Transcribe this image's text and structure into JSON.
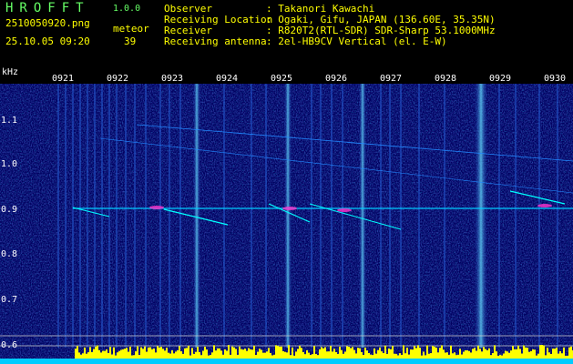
{
  "header": {
    "app_title": "HROFFT",
    "app_version": "1.0.0",
    "filename": "2510050920.png",
    "meteor_label": "meteor",
    "datetime": "25.10.05 09:20",
    "meteor_count": "39",
    "info": [
      {
        "key": "Observer",
        "value": ": Takanori Kawachi"
      },
      {
        "key": "Receiving Location",
        "value": ": Ogaki, Gifu, JAPAN (136.60E, 35.35N)"
      },
      {
        "key": "Receiver",
        "value": ": R820T2(RTL-SDR) SDR-Sharp 53.1000MHz"
      },
      {
        "key": "Receiving antenna",
        "value": ": 2el-HB9CV Vertical (el. E-W)"
      }
    ]
  },
  "axis": {
    "unit": "kHz",
    "time_ticks": [
      "0921",
      "0922",
      "0923",
      "0924",
      "0925",
      "0926",
      "0927",
      "0928",
      "0929",
      "0930"
    ],
    "freq_ticks": [
      "1.1",
      "1.0",
      "0.9",
      "0.8",
      "0.7",
      "0.6"
    ]
  },
  "colors": {
    "background": "#000000",
    "plot_background": "#000060",
    "title_green": "#66ff66",
    "text_yellow": "#ffff00",
    "trace_cyan": "#00ffff",
    "echo_magenta": "#ff33cc",
    "baseline_yellow": "#ffff00"
  }
}
